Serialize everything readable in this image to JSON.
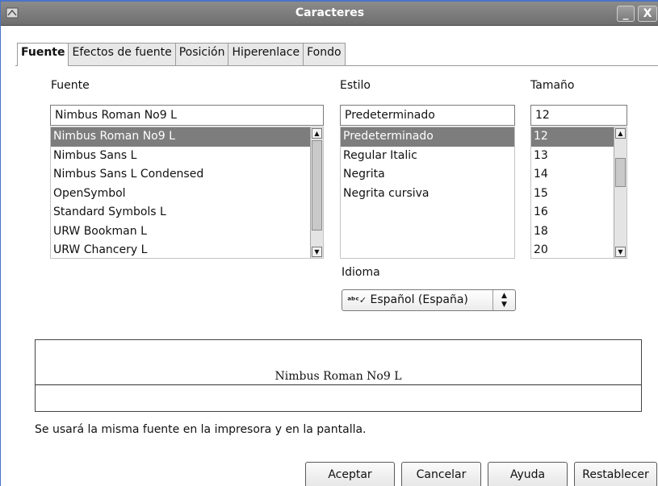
{
  "window": {
    "title": "Caracteres",
    "minimize_label": "_",
    "close_label": "X"
  },
  "tabs": [
    {
      "label": "Fuente",
      "active": true
    },
    {
      "label": "Efectos de fuente",
      "active": false
    },
    {
      "label": "Posición",
      "active": false
    },
    {
      "label": "Hiperenlace",
      "active": false
    },
    {
      "label": "Fondo",
      "active": false
    }
  ],
  "font": {
    "label": "Fuente",
    "value": "Nimbus Roman No9 L",
    "options": [
      "Nimbus Roman No9 L",
      "Nimbus Sans L",
      "Nimbus Sans L Condensed",
      "OpenSymbol",
      "Standard Symbols L",
      "URW Bookman L",
      "URW Chancery L"
    ],
    "selected_index": 0
  },
  "style": {
    "label": "Estilo",
    "value": "Predeterminado",
    "options": [
      "Predeterminado",
      "Regular Italic",
      "Negrita",
      "Negrita cursiva"
    ],
    "selected_index": 0
  },
  "size": {
    "label": "Tamaño",
    "value": "12",
    "options": [
      "12",
      "13",
      "14",
      "15",
      "16",
      "18",
      "20"
    ],
    "selected_index": 0
  },
  "language": {
    "label": "Idioma",
    "value": "Español (España)",
    "icon": "spellcheck-icon"
  },
  "preview": {
    "text": "Nimbus Roman No9 L"
  },
  "note": "Se usará la misma fuente en la impresora y en la pantalla.",
  "buttons": {
    "ok": "Aceptar",
    "cancel": "Cancelar",
    "help": "Ayuda",
    "reset": "Restablecer"
  },
  "colors": {
    "selection": "#7d7d7d",
    "titlebar": "#7a7a7a",
    "frame": "#4a72c8"
  }
}
